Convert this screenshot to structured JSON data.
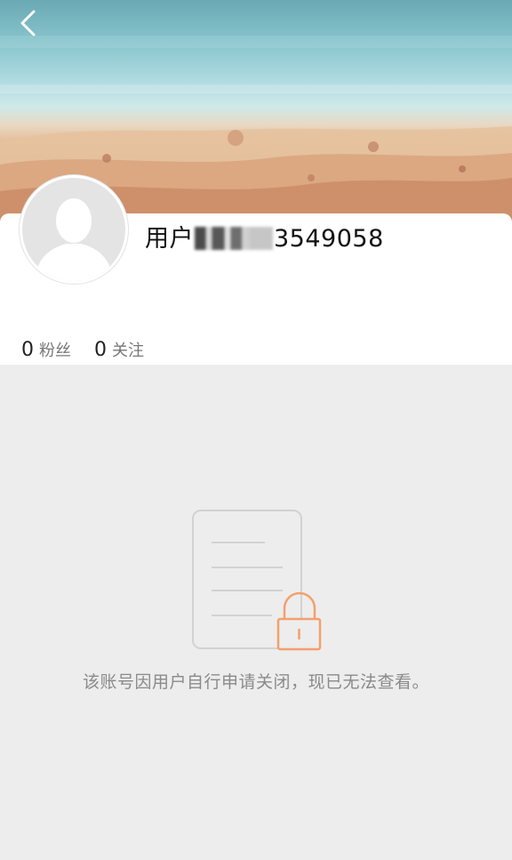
{
  "header": {
    "back_icon": "chevron-left-icon"
  },
  "profile": {
    "avatar_icon": "default-avatar-icon",
    "username_prefix": "用户",
    "username_suffix": "3549058",
    "followers": {
      "count": "0",
      "label": "粉丝"
    },
    "following": {
      "count": "0",
      "label": "关注"
    }
  },
  "notice": {
    "icon": "locked-document-icon",
    "message": "该账号因用户自行申请关闭，现已无法查看。"
  },
  "colors": {
    "background": "#ededed",
    "card": "#ffffff",
    "lock_accent": "#f3a06c"
  }
}
